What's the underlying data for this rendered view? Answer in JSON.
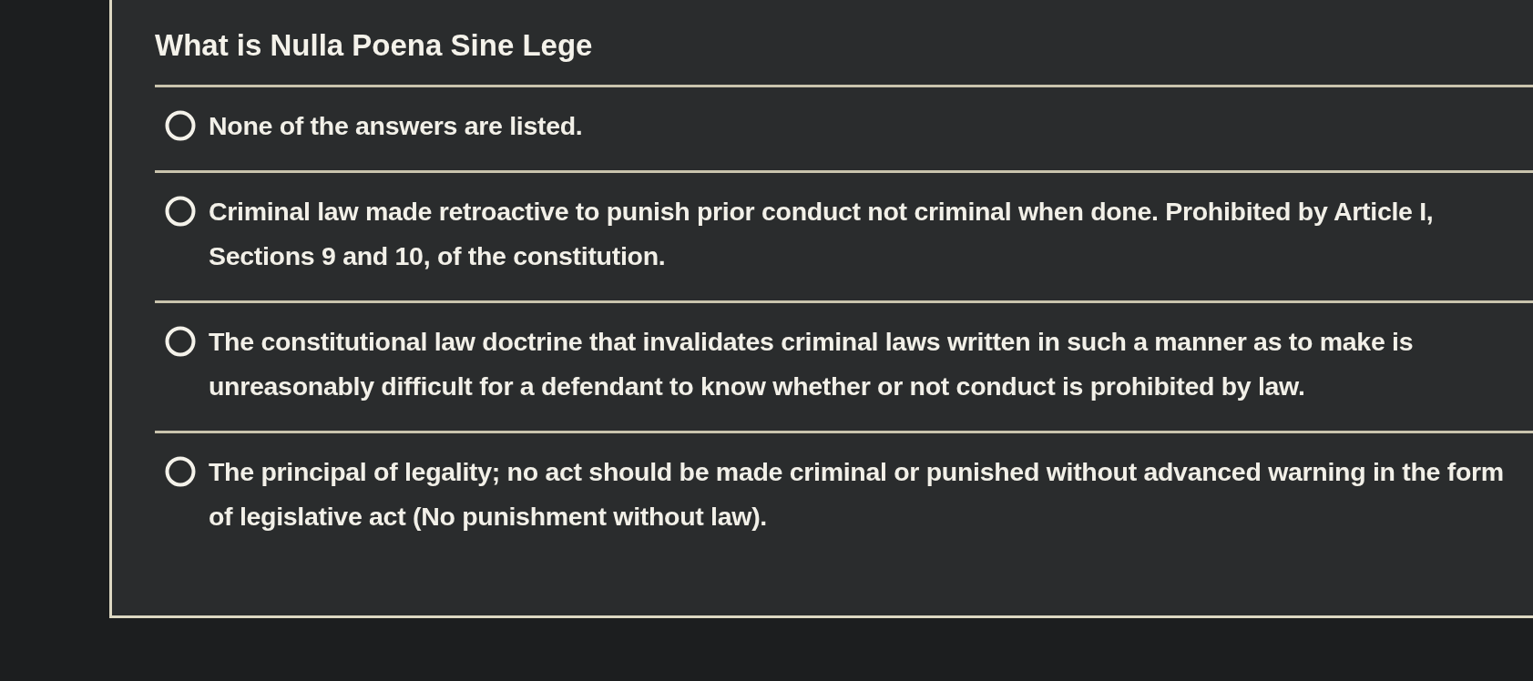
{
  "question": {
    "title": "What is Nulla Poena Sine Lege"
  },
  "options": [
    {
      "text": "None of the answers are listed.",
      "selected": false
    },
    {
      "text": "Criminal law made retroactive to punish prior conduct not criminal when done. Prohibited by Article I, Sections 9 and 10, of the constitution.",
      "selected": false
    },
    {
      "text": "The constitutional law doctrine that invalidates criminal laws written in such a manner as to make is unreasonably difficult for a defendant to know whether or not conduct is prohibited by law.",
      "selected": false
    },
    {
      "text": "The principal of legality; no act should be made criminal or punished without advanced warning in the form of legislative act (No punishment without law).",
      "selected": false
    }
  ]
}
